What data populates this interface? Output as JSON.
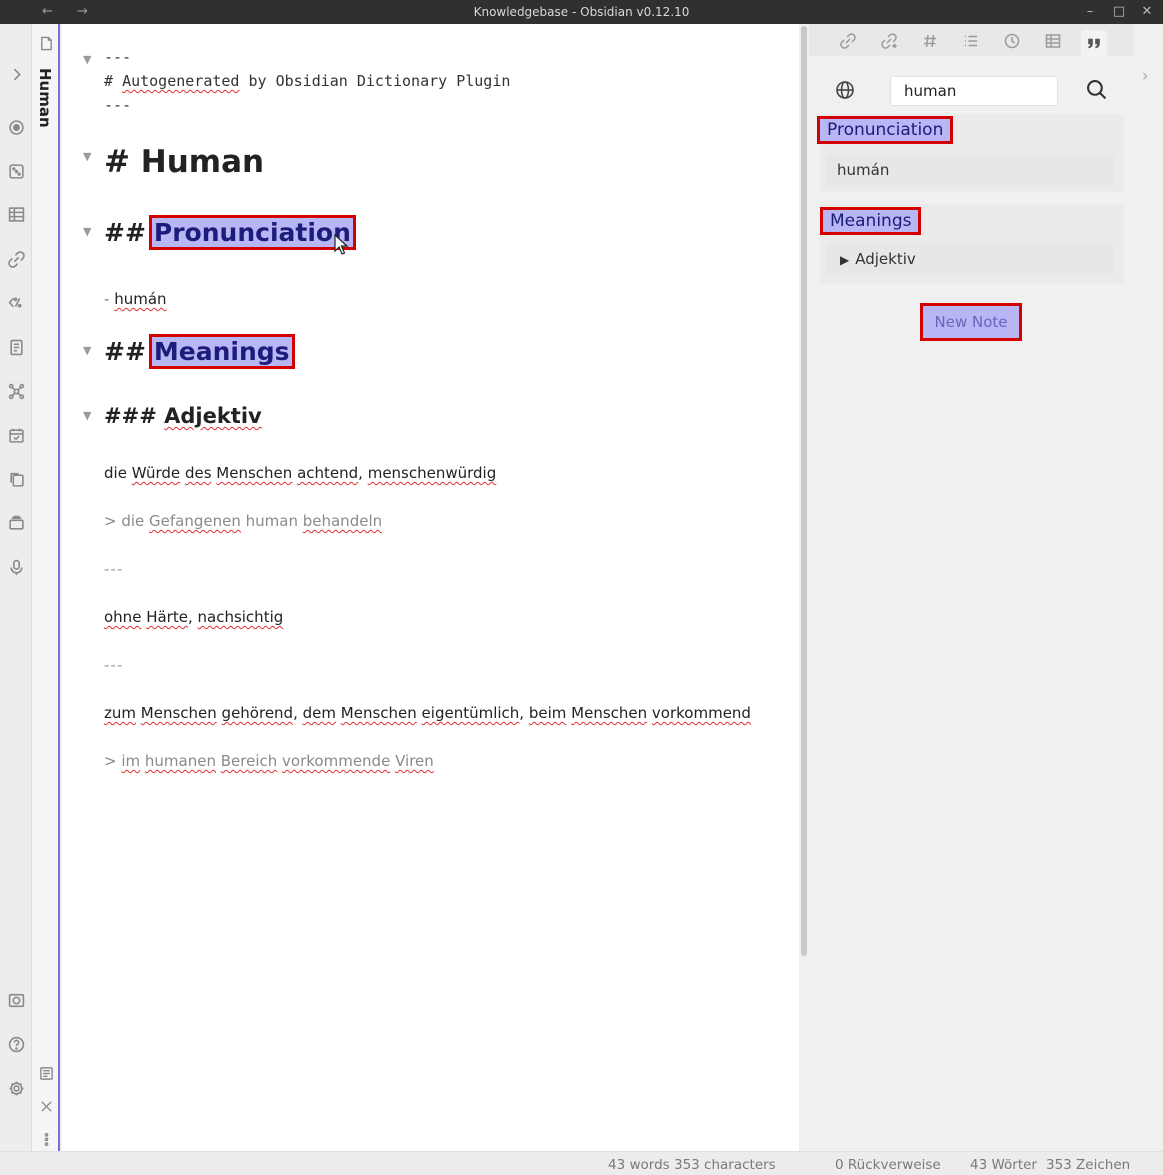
{
  "window": {
    "title": "Knowledgebase - Obsidian v0.12.10",
    "back_glyph": "←",
    "forward_glyph": "→",
    "minimize_glyph": "–",
    "maximize_glyph": "□",
    "close_glyph": "✕"
  },
  "sidebar": {
    "collapsed_title": "Human"
  },
  "editor": {
    "frontmatter_open": "---",
    "frontmatter_comment_prefix": "# ",
    "frontmatter_comment_word": "Autogenerated",
    "frontmatter_comment_rest": " by Obsidian Dictionary Plugin",
    "frontmatter_close": "---",
    "h1": "# Human",
    "h2_hash": "##",
    "h2_pronunciation": "Pronunciation",
    "pronunciation_prefix": "- ",
    "pronunciation_value": "humán",
    "h2_meanings": "Meanings",
    "h3_prefix": "### ",
    "h3_adjektiv": "Adjektiv",
    "meanings": {
      "m1_text": {
        "w1": "die ",
        "w2": "Würde",
        "w3": " ",
        "w4": "des",
        "w5": " ",
        "w6": "Menschen",
        "w7": " ",
        "w8": "achtend",
        "w9": ", ",
        "w10": "menschenwürdig"
      },
      "m1_quote": {
        "w1": "> die ",
        "w2": "Gefangenen",
        "w3": " human ",
        "w4": "behandeln"
      },
      "sep1": "---",
      "m2_text": {
        "w1": "ohne",
        "w2": " ",
        "w3": "Härte",
        "w4": ", ",
        "w5": "nachsichtig"
      },
      "sep2": "---",
      "m3_text": {
        "w1": "zum",
        "w2": " ",
        "w3": "Menschen",
        "w4": " ",
        "w5": "gehörend",
        "w6": ", ",
        "w7": "dem",
        "w8": " ",
        "w9": "Menschen",
        "w10": " ",
        "w11": "eigentümlich",
        "w12": ", ",
        "w13": "beim",
        "w14": " ",
        "w15": "Menschen",
        "w16": " ",
        "w17": "vorkommend"
      },
      "m3_quote": {
        "w1": "> ",
        "w2": "im",
        "w3": " ",
        "w4": "humanen",
        "w5": " ",
        "w6": "Bereich",
        "w7": " ",
        "w8": "vorkommende",
        "w9": " ",
        "w10": "Viren"
      }
    }
  },
  "dictionary_panel": {
    "search_value": "human",
    "pronunciation_title": "Pronunciation",
    "pronunciation_value": "humán",
    "meanings_title": "Meanings",
    "meanings_item": "Adjektiv",
    "meanings_item_marker": "▶",
    "new_note_label": "New Note"
  },
  "statusbar": {
    "words_chars": "43 words 353 characters",
    "backlinks": "0 Rückverweise",
    "words_de": "43 Wörter",
    "chars_de": "353 Zeichen"
  },
  "colors": {
    "highlight_bg": "#b8b6f5",
    "highlight_text": "#1c1c7a",
    "annotation_border": "#d40000",
    "accent": "#7b6cd9"
  }
}
